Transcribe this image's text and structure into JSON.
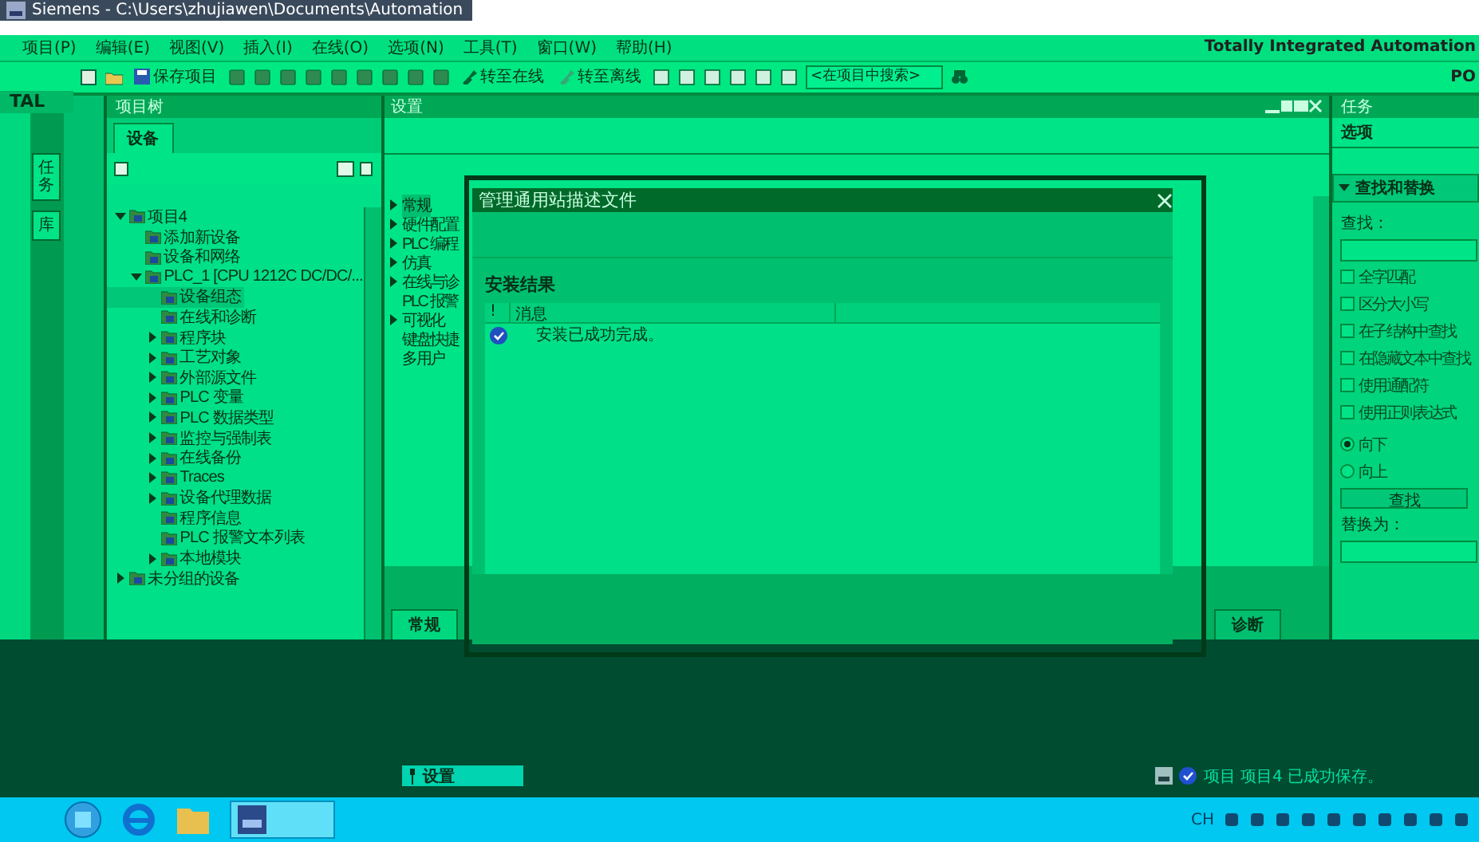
{
  "window": {
    "title": "Siemens  -  C:\\Users\\zhujiawen\\Documents\\Automation",
    "brand": "Totally Integrated Automation",
    "brand_sub": "PO"
  },
  "menu": [
    {
      "label": "项目(P)"
    },
    {
      "label": "编辑(E)"
    },
    {
      "label": "视图(V)"
    },
    {
      "label": "插入(I)"
    },
    {
      "label": "在线(O)"
    },
    {
      "label": "选项(N)"
    },
    {
      "label": "工具(T)"
    },
    {
      "label": "窗口(W)"
    },
    {
      "label": "帮助(H)"
    }
  ],
  "toolbar": {
    "save": "保存项目",
    "go_online": "转至在线",
    "go_offline": "转至离线",
    "search": {
      "placeholder": "<在项目中搜索>"
    }
  },
  "portal_label": "TAL",
  "side_tabs": [
    {
      "label": "任务"
    },
    {
      "label": "库"
    }
  ],
  "project_tree": {
    "title": "项目树",
    "tab": "设备",
    "items": [
      {
        "label": "项目4",
        "expanded": true,
        "selected": false,
        "children": [
          {
            "label": "添加新设备",
            "selected": false
          },
          {
            "label": "设备和网络",
            "selected": false
          },
          {
            "label": "PLC_1 [CPU 1212C DC/DC/...",
            "expanded": true,
            "selected": false,
            "children": [
              {
                "label": "设备组态",
                "selected": true
              },
              {
                "label": "在线和诊断",
                "selected": false
              },
              {
                "label": "程序块",
                "expanded": false,
                "selected": false
              },
              {
                "label": "工艺对象",
                "expanded": false,
                "selected": false
              },
              {
                "label": "外部源文件",
                "expanded": false,
                "selected": false
              },
              {
                "label": "PLC 变量",
                "expanded": false,
                "selected": false
              },
              {
                "label": "PLC 数据类型",
                "expanded": false,
                "selected": false
              },
              {
                "label": "监控与强制表",
                "expanded": false,
                "selected": false
              },
              {
                "label": "在线备份",
                "expanded": false,
                "selected": false
              },
              {
                "label": "Traces",
                "expanded": false,
                "selected": false
              },
              {
                "label": "设备代理数据",
                "expanded": false,
                "selected": false
              },
              {
                "label": "程序信息",
                "selected": false
              },
              {
                "label": "PLC 报警文本列表",
                "selected": false
              },
              {
                "label": "本地模块",
                "expanded": false,
                "selected": false
              }
            ]
          }
        ]
      },
      {
        "label": "未分组的设备",
        "expanded": false,
        "selected": false
      }
    ]
  },
  "settings": {
    "title": "设置",
    "nav": [
      {
        "label": "常规",
        "expanded": false,
        "selected": true
      },
      {
        "label": "硬件配置",
        "expanded": false,
        "selected": false
      },
      {
        "label": "PLC 编程",
        "expanded": false,
        "selected": false
      },
      {
        "label": "仿真",
        "expanded": false,
        "selected": false
      },
      {
        "label": "在线与诊",
        "expanded": false,
        "selected": false
      },
      {
        "label": "PLC 报警",
        "selected": false
      },
      {
        "label": "可视化",
        "expanded": false,
        "selected": false
      },
      {
        "label": "键盘快捷",
        "selected": false
      },
      {
        "label": "多用户",
        "selected": false
      }
    ],
    "inspector_tabs": [
      {
        "label": "常规",
        "selected": true
      },
      {
        "label": "诊断",
        "selected": false
      }
    ]
  },
  "dialog": {
    "title": "管理通用站描述文件",
    "section": "安装结果",
    "columns": [
      "!",
      "消息"
    ],
    "rows": [
      {
        "succeeded": true,
        "message": "安装已成功完成。"
      }
    ]
  },
  "tasks": {
    "title": "任务",
    "section": "选项",
    "find_replace": "查找和替换",
    "find_label": "查找：",
    "options": [
      {
        "label": "全字匹配",
        "checked": false
      },
      {
        "label": "区分大小写",
        "checked": false
      },
      {
        "label": "在子结构中查找",
        "checked": false
      },
      {
        "label": "在隐藏文本中查找",
        "checked": false
      },
      {
        "label": "使用通配符",
        "checked": false
      },
      {
        "label": "使用正则表达式",
        "checked": false
      }
    ],
    "directions": [
      {
        "label": "向下",
        "selected": true
      },
      {
        "label": "向上",
        "selected": false
      }
    ],
    "find_button": "查找",
    "replace_label": "替换为："
  },
  "status_bar": {
    "tabs": [
      {
        "label": "设置",
        "selected": true
      }
    ],
    "message": "项目 项目4 已成功保存。"
  },
  "taskbar": {
    "language": "CH"
  }
}
